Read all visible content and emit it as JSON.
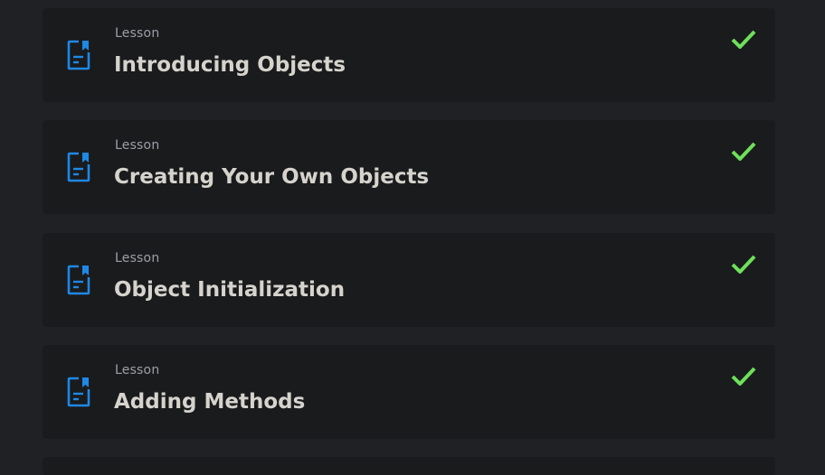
{
  "accent_color": "#1e88e5",
  "check_color": "#6ee05a",
  "lessons": [
    {
      "kind": "Lesson",
      "title": "Introducing Objects",
      "completed": true,
      "icon": "lesson-doc-icon"
    },
    {
      "kind": "Lesson",
      "title": "Creating Your Own Objects",
      "completed": true,
      "icon": "lesson-doc-icon"
    },
    {
      "kind": "Lesson",
      "title": "Object Initialization",
      "completed": true,
      "icon": "lesson-doc-icon"
    },
    {
      "kind": "Lesson",
      "title": "Adding Methods",
      "completed": true,
      "icon": "lesson-doc-icon"
    }
  ]
}
